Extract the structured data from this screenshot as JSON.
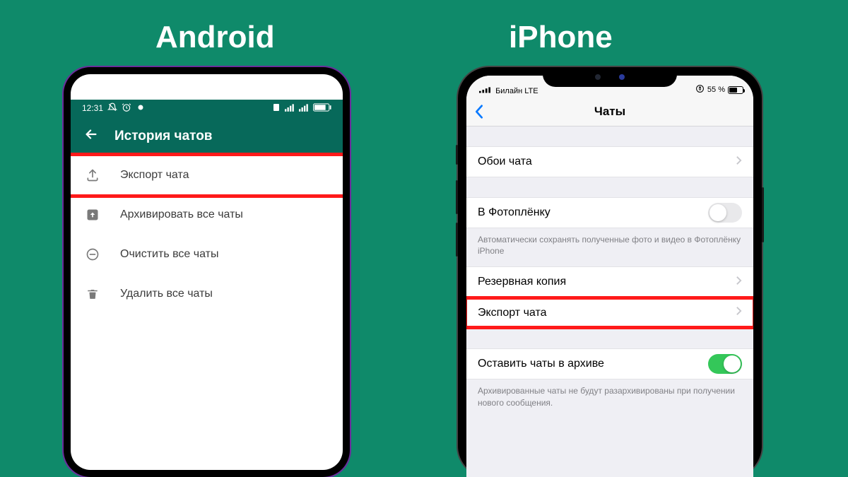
{
  "labels": {
    "android": "Android",
    "iphone": "iPhone"
  },
  "android": {
    "status": {
      "time": "12:31"
    },
    "header": {
      "title": "История чатов"
    },
    "items": [
      {
        "label": "Экспорт чата",
        "icon": "upload",
        "highlight": true
      },
      {
        "label": "Архивировать все чаты",
        "icon": "archive"
      },
      {
        "label": "Очистить все чаты",
        "icon": "clear"
      },
      {
        "label": "Удалить все чаты",
        "icon": "trash"
      }
    ]
  },
  "iphone": {
    "status": {
      "carrier": "Билайн  LTE",
      "battery_pct": "55 %",
      "battery_fill": 55
    },
    "nav": {
      "title": "Чаты"
    },
    "section1": {
      "row0": "Обои чата"
    },
    "section2": {
      "row0": "В Фотоплёнку",
      "footer": "Автоматически сохранять полученные фото и видео в Фотоплёнку iPhone"
    },
    "section3": {
      "row0": "Резервная копия",
      "row1": "Экспорт чата"
    },
    "section4": {
      "row0": "Оставить чаты в архиве",
      "footer": "Архивированные чаты не будут разархивированы при получении нового сообщения."
    }
  }
}
